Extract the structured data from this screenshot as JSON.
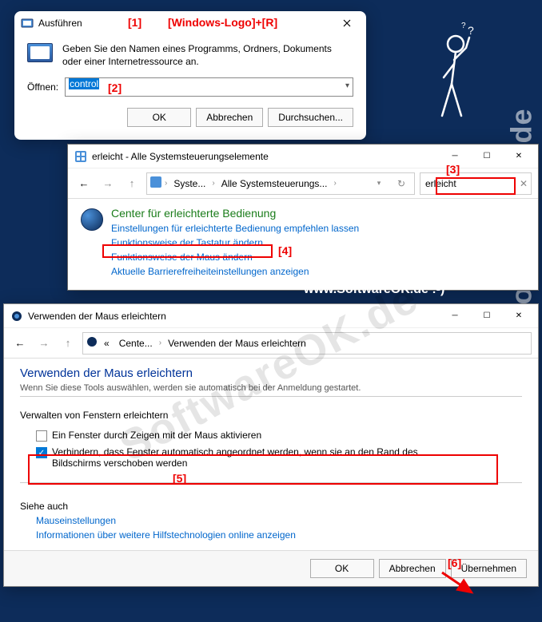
{
  "run": {
    "title": "Ausführen",
    "desc": "Geben Sie den Namen eines Programms, Ordners, Dokuments oder einer Internetressource an.",
    "open_label": "Öffnen:",
    "value": "control",
    "ok": "OK",
    "cancel": "Abbrechen",
    "browse": "Durchsuchen..."
  },
  "annotations": {
    "a1": "[1]",
    "a1_text": "[Windows-Logo]+[R]",
    "a2": "[2]",
    "a3": "[3]",
    "a4": "[4]",
    "a5": "[5]",
    "a6": "[6]"
  },
  "cp": {
    "title": "erleicht - Alle Systemsteuerungselemente",
    "crumb1": "Syste...",
    "crumb2": "Alle Systemsteuerungs...",
    "search": "erleicht",
    "heading": "Center für erleichterte Bedienung",
    "link1": "Einstellungen für erleichterte Bedienung empfehlen lassen",
    "link2": "Funktionsweise der Tastatur ändern",
    "link3": "Funktionsweise der Maus ändern",
    "link4": "Aktuelle Barrierefreiheiteinstellungen anzeigen"
  },
  "url": "www.SoftwareOK.de :-)",
  "watermark": "SoftwareOK.de",
  "mouse": {
    "title": "Verwenden der Maus erleichtern",
    "crumb1": "Cente...",
    "crumb2": "Verwenden der Maus erleichtern",
    "heading": "Verwenden der Maus erleichtern",
    "subtext": "Wenn Sie diese Tools auswählen, werden sie automatisch bei der Anmeldung gestartet.",
    "section": "Verwalten von Fenstern erleichtern",
    "check1": "Ein Fenster durch Zeigen mit der Maus aktivieren",
    "check2": "Verhindern, dass Fenster automatisch angeordnet werden, wenn sie an den Rand des Bildschirms verschoben werden",
    "see_also": "Siehe auch",
    "link1": "Mauseinstellungen",
    "link2": "Informationen über weitere Hilfstechnologien online anzeigen",
    "ok": "OK",
    "cancel": "Abbrechen",
    "apply": "Übernehmen"
  }
}
